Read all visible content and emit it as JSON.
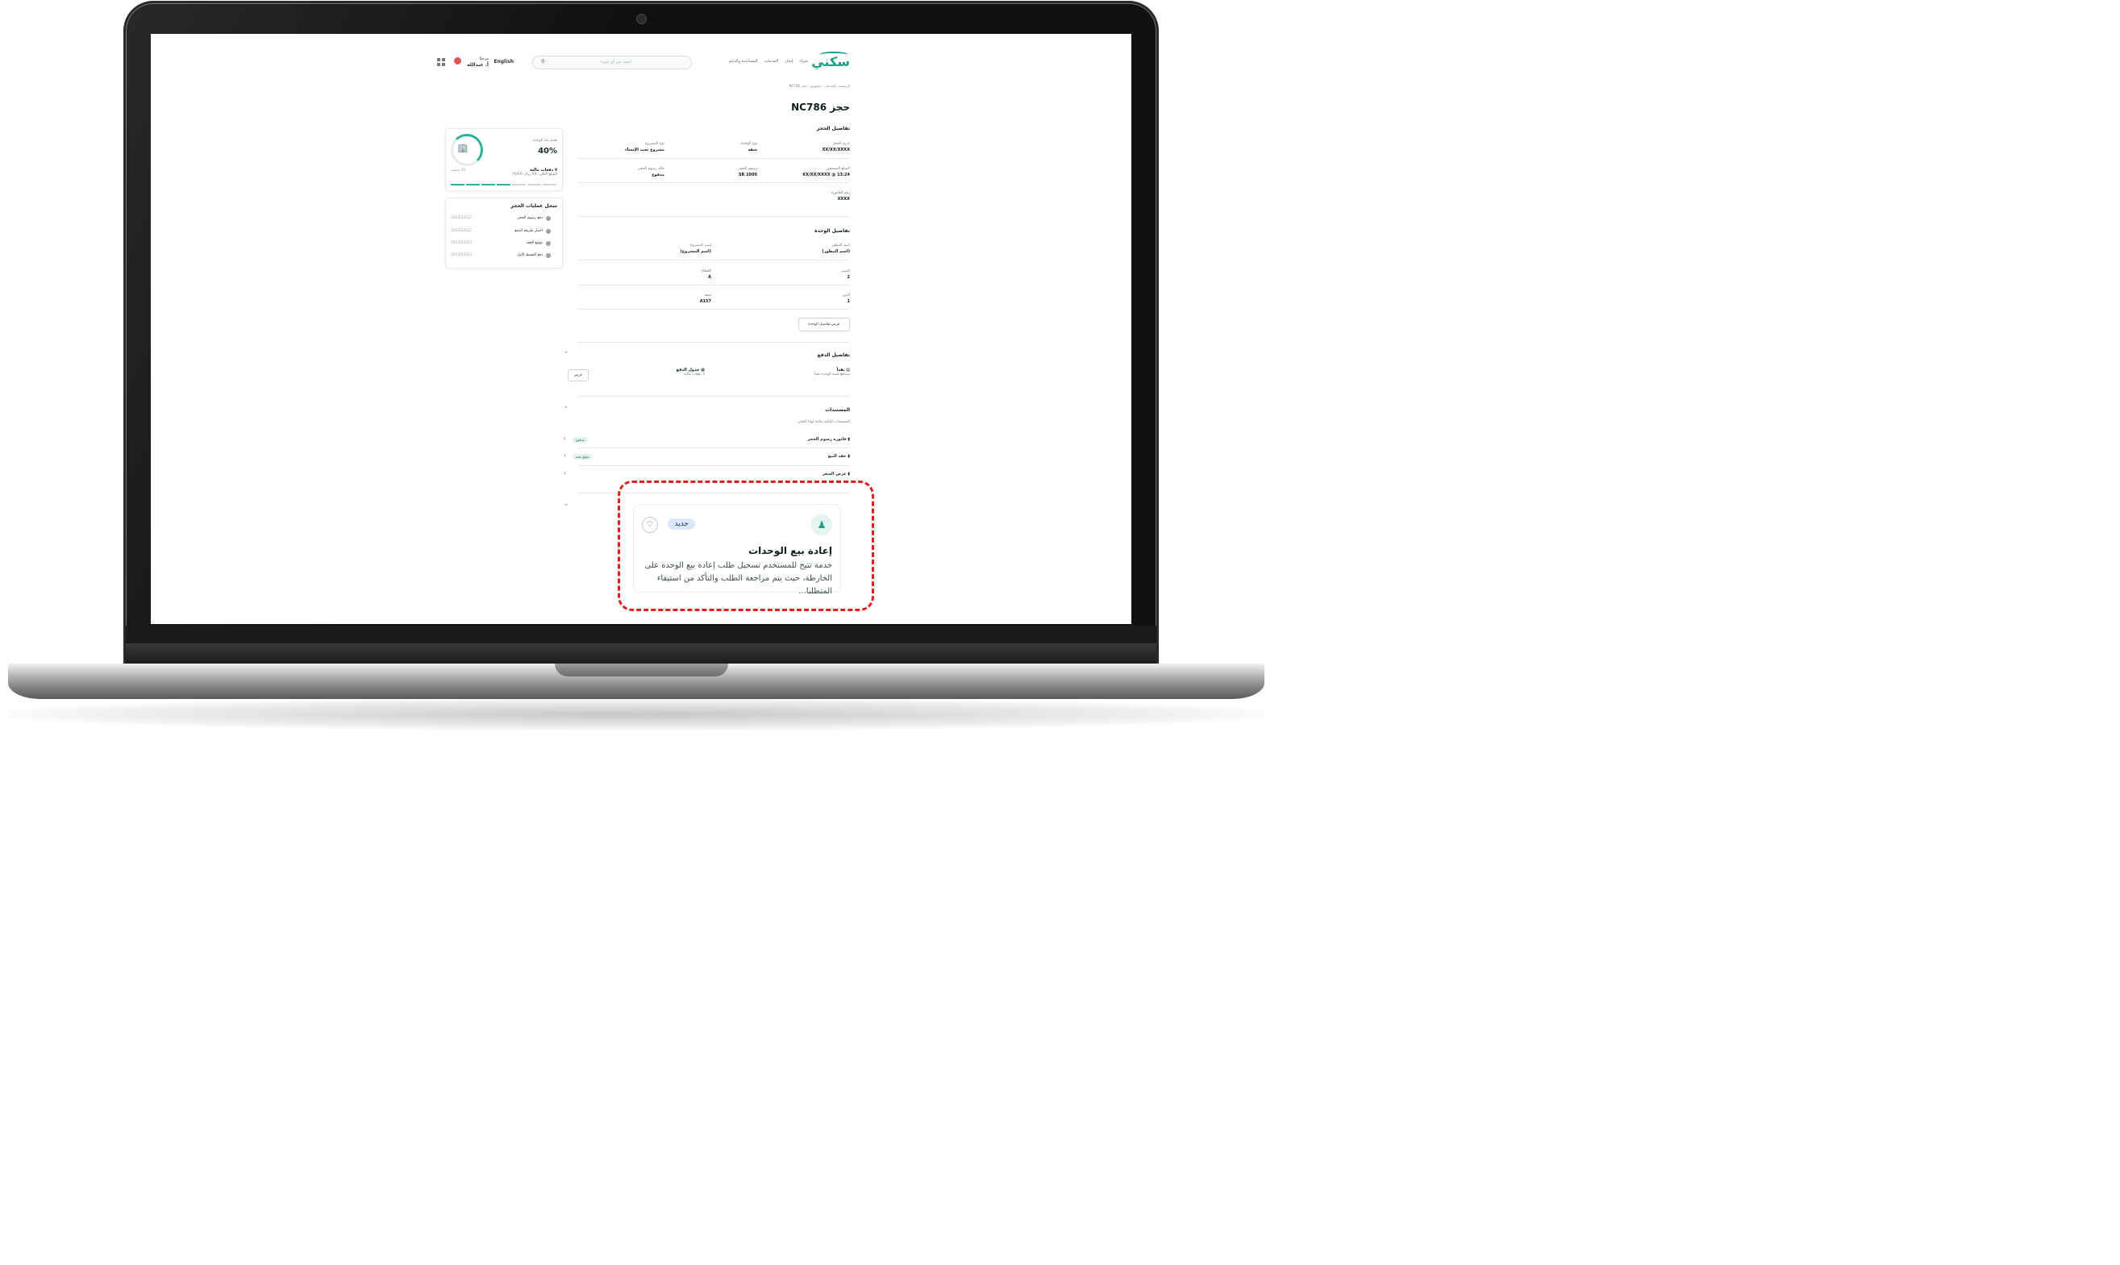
{
  "nav": {
    "logo": "سكني",
    "links": [
      "شراء",
      "إيجار",
      "الخدمات",
      "المساعدة والدعم"
    ],
    "search_placeholder": "ابحث عن أي شيء",
    "language": "English",
    "greeting": "مرحبًا",
    "user_name": "أ. عبدالله"
  },
  "breadcrumb": "الرئيسية ‹ الخدمات ‹ سجوري ‹ حجز NC786",
  "page_title": "حجز NC786",
  "booking": {
    "heading": "تفاصيل الحجز",
    "fields": [
      {
        "label": "تاريخ الحجز",
        "value": "XX/XX/XXXX"
      },
      {
        "label": "نوع الوحدة",
        "value": "شقة"
      },
      {
        "label": "نوع المشروع",
        "value": "مشروع تحت الإنشاء"
      },
      {
        "label": "المبلغ المستحق",
        "value": "XX/XX/XXXX @ 13:24"
      },
      {
        "label": "رسوم الحجز",
        "value": "SR 1000"
      },
      {
        "label": "حالة رسوم الحجز",
        "value": "مدفوع"
      },
      {
        "label": "رقم الفاتورة",
        "value": "XXXX"
      }
    ]
  },
  "unit": {
    "heading": "تفاصيل الوحدة",
    "fields": [
      {
        "label": "اسم المطور",
        "value": "(اسم المطور)"
      },
      {
        "label": "اسم المشروع",
        "value": "(اسم المشروع)"
      },
      {
        "label": "المبنى",
        "value": "2"
      },
      {
        "label": "القطاع",
        "value": "A"
      },
      {
        "label": "الدور",
        "value": "1"
      },
      {
        "label": "شقة",
        "value": "A157"
      }
    ],
    "button": "عرض تفاصيل الوحدة"
  },
  "payment": {
    "heading": "تفاصيل الدفع",
    "method_label": "نقداً",
    "method_sub": "ستدفع قيمة الوحدة نقداً",
    "schedule_label": "جدول الدفع",
    "schedule_sub": "٧ دفعات مالية",
    "view_button": "عرض"
  },
  "documents": {
    "heading": "المستندات",
    "sub": "المستندات التالية متاحة لهذا الحجز",
    "items": [
      {
        "label": "فاتورة رسوم الحجز",
        "status": "مدفوع"
      },
      {
        "label": "عقد البيع",
        "status": "موقع عليه"
      },
      {
        "label": "عرض السعر",
        "status": ""
      }
    ]
  },
  "progress": {
    "title": "تقدم بناء الوحدة",
    "percent": "40%",
    "percent_value": 0.4,
    "payments": "٧ دفعات مالية",
    "payments_sub": "المبلغ الكلي: XX ريال (XX%)",
    "remaining": "XX متبقية"
  },
  "history": {
    "title": "سجل عمليات الحجز",
    "steps": [
      {
        "label": "دفع رسوم الحجز",
        "date": "2023/12/12"
      },
      {
        "label": "اختيار طريقة الدفع",
        "date": "2023/12/12"
      },
      {
        "label": "توقيع العقد",
        "date": "2023/12/13"
      },
      {
        "label": "دفع القسط الأول",
        "date": "2023/12/13"
      }
    ]
  },
  "service_card": {
    "badge": "جديد",
    "title": "إعادة بيع الوحدات",
    "description": "خدمة تتيح للمستخدم تسجيل طلب إعادة بيع الوحدة على الخارطة، حيث يتم مراجعة الطلب والتأكد من استيفاء المتطلبا..."
  },
  "colors": {
    "accent": "#1a9f87",
    "highlight": "#e01e1e",
    "badge_bg": "#dbe8fb"
  }
}
